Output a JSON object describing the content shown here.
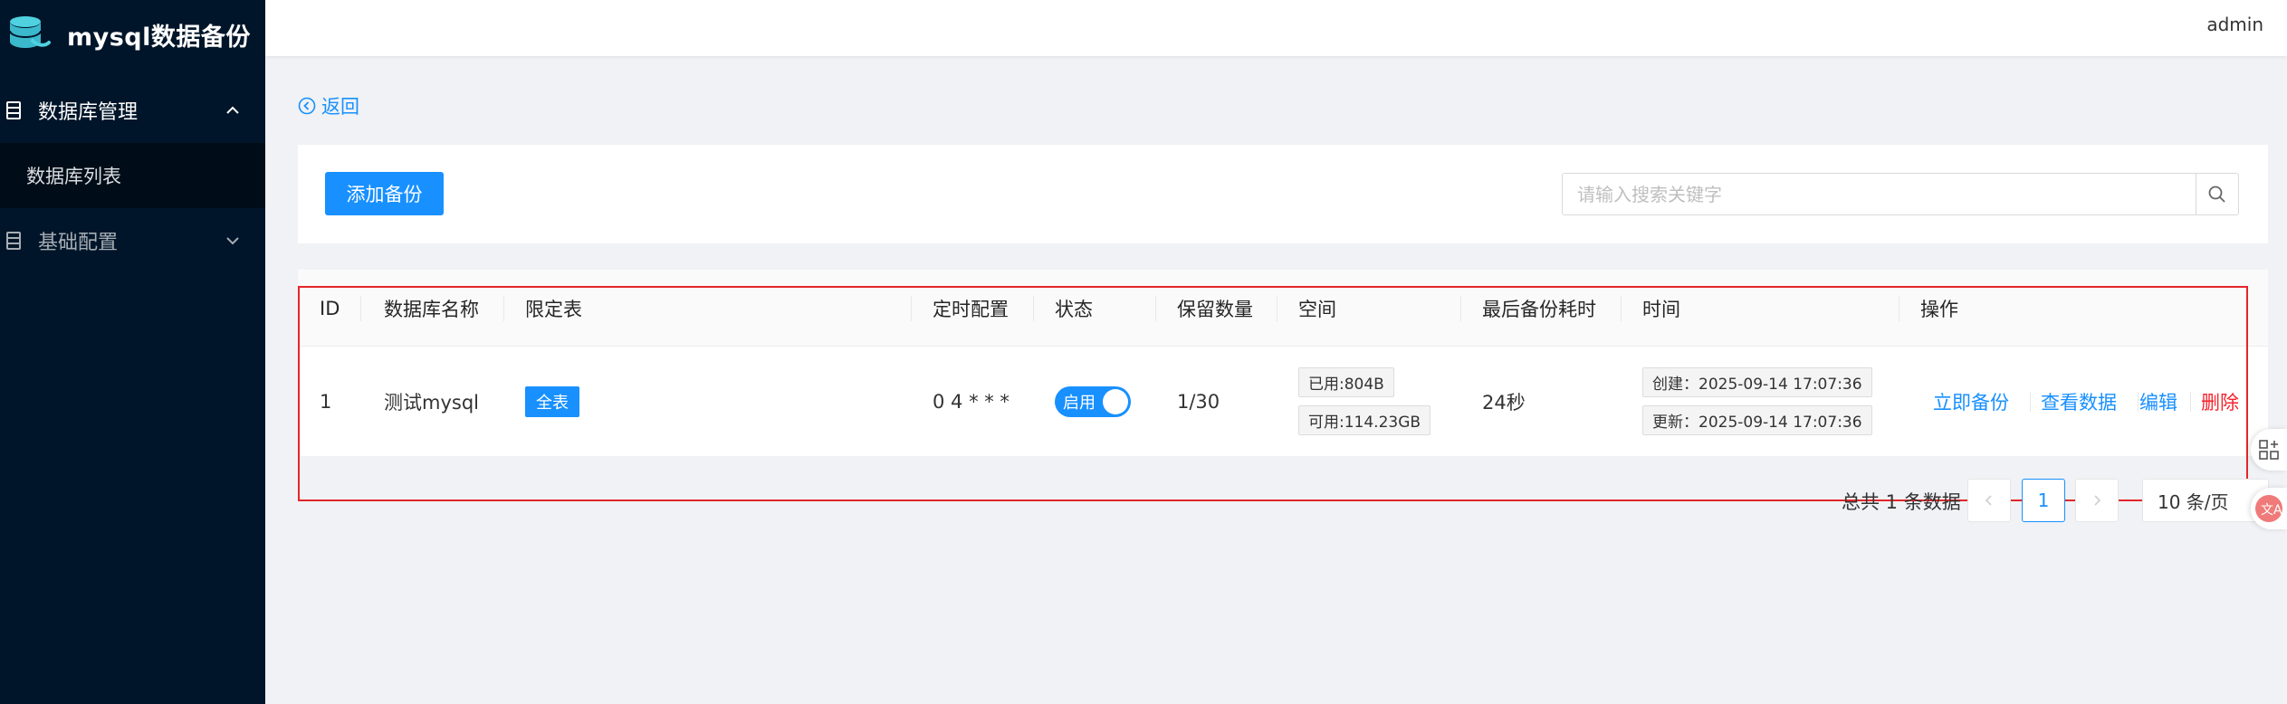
{
  "app": {
    "title": "mysql数据备份",
    "user": "admin"
  },
  "sidebar": {
    "groups": [
      {
        "label": "数据库管理",
        "expanded": true,
        "items": [
          {
            "label": "数据库列表"
          }
        ]
      },
      {
        "label": "基础配置",
        "expanded": false,
        "items": []
      }
    ]
  },
  "page": {
    "back_label": "返回",
    "add_button": "添加备份",
    "search_placeholder": "请输入搜索关键字"
  },
  "table": {
    "headers": [
      "ID",
      "数据库名称",
      "限定表",
      "定时配置",
      "状态",
      "保留数量",
      "空间",
      "最后备份耗时",
      "时间",
      "操作"
    ],
    "rows": [
      {
        "id": "1",
        "name": "测试mysql",
        "tables_tag": "全表",
        "cron": "0 4 * * *",
        "status": "启用",
        "status_on": true,
        "retention": "1/30",
        "space_used": "已用:804B",
        "space_free": "可用:114.23GB",
        "last_duration": "24秒",
        "created": "创建：2025-09-14 17:07:36",
        "updated": "更新：2025-09-14 17:07:36",
        "actions": {
          "backup": "立即备份",
          "view": "查看数据",
          "edit": "编辑",
          "delete": "删除"
        }
      }
    ]
  },
  "pagination": {
    "total_text": "总共 1 条数据",
    "current_page": "1",
    "page_size": "10 条/页"
  },
  "colors": {
    "sidebar_bg": "#001529",
    "primary": "#1890ff",
    "danger": "#f5222d",
    "highlight_box": "#e3262a"
  }
}
